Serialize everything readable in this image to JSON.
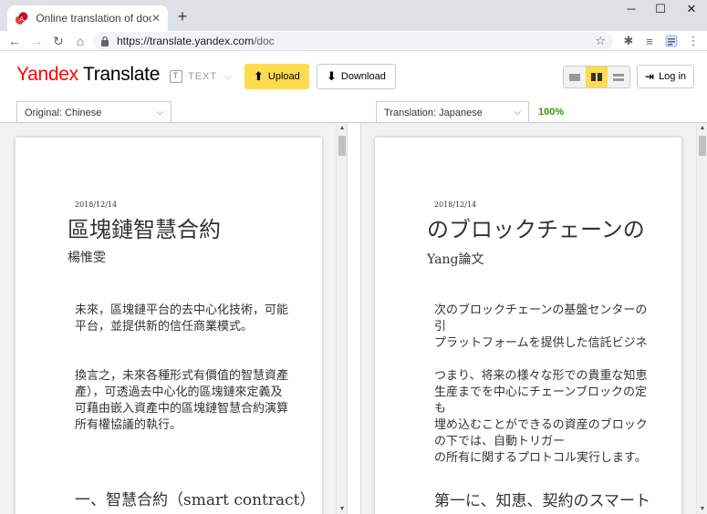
{
  "browser": {
    "tab_title": "Online translation of documents",
    "url_host": "https://translate.yandex.com",
    "url_path": "/doc",
    "new_tab": "+",
    "close_tab": "✕"
  },
  "app": {
    "logo_brand": "Yandex",
    "logo_product": "Translate",
    "text_mode_label": "TEXT",
    "upload_label": "Upload",
    "download_label": "Download",
    "login_label": "Log in"
  },
  "source": {
    "language_label": "Original: Chinese",
    "doc": {
      "date": "2018/12/14",
      "title": "區塊鏈智慧合約",
      "author": "楊惟雯",
      "para1": [
        "未來，區塊鏈平台的去中心化技術，可能",
        "平台，並提供新的信任商業模式。"
      ],
      "para2": [
        "換言之，未來各種形式有價值的智慧資產",
        "產），可透過去中心化的區塊鏈來定義及",
        "可藉由嵌入資產中的區塊鏈智慧合約演算",
        "所有權協議的執行。"
      ],
      "heading_cn": "一、智慧合約",
      "heading_en": "（smart contract）"
    }
  },
  "target": {
    "language_label": "Translation: Japanese",
    "progress": "100%",
    "doc": {
      "date": "2018/12/14",
      "title": "のブロックチェーンの",
      "author": "Yang論文",
      "para1": [
        "次のブロックチェーンの基盤センターの",
        "引",
        "プラットフォームを提供した信託ビジネ"
      ],
      "para2": [
        "つまり、将来の様々な形での貴重な知恵",
        "生産までを中心にチェーンブロックの定",
        "も",
        "埋め込むことができるの資産のブロック",
        "の下では、自動トリガー",
        "の所有に関するプロトコル実行します。"
      ],
      "heading": "第一に、知恵、契約のスマート"
    }
  }
}
